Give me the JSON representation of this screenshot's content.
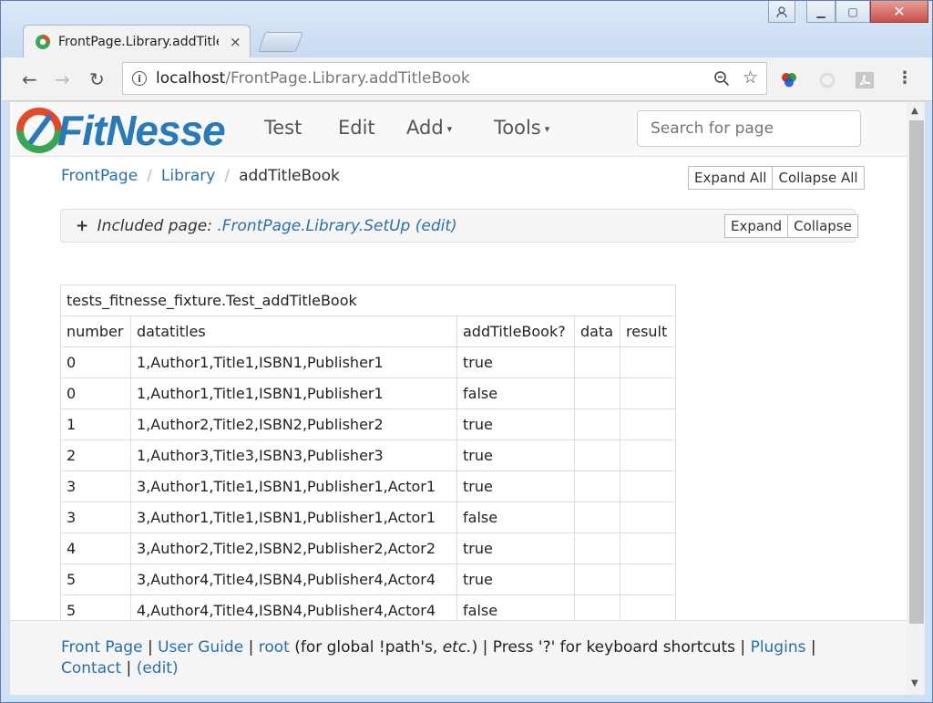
{
  "browser": {
    "tab_title": "FrontPage.Library.addTitle",
    "tab_close": "×",
    "url_host": "localhost",
    "url_path": "/FrontPage.Library.addTitleBook"
  },
  "header": {
    "logo_text": "FitNesse",
    "menu": [
      {
        "label": "Test",
        "caret": ""
      },
      {
        "label": "Edit",
        "caret": ""
      },
      {
        "label": "Add",
        "caret": "▾"
      },
      {
        "label": "Tools",
        "caret": "▾"
      }
    ],
    "search_placeholder": "Search for page"
  },
  "breadcrumb": {
    "items": [
      "FrontPage",
      "Library"
    ],
    "current": "addTitleBook",
    "separator": "/"
  },
  "page_buttons": {
    "expand_all": "Expand All",
    "collapse_all": "Collapse All"
  },
  "included": {
    "plus": "+",
    "label": "Included page:",
    "link": ".FrontPage.Library.SetUp",
    "edit": "(edit)",
    "expand": "Expand",
    "collapse": "Collapse"
  },
  "table": {
    "fixture": "tests_fitnesse_fixture.Test_addTitleBook",
    "headers": [
      "number",
      "datatitles",
      "addTitleBook?",
      "data",
      "result"
    ],
    "rows": [
      [
        "0",
        "1,Author1,Title1,ISBN1,Publisher1",
        "true",
        "",
        ""
      ],
      [
        "0",
        "1,Author1,Title1,ISBN1,Publisher1",
        "false",
        "",
        ""
      ],
      [
        "1",
        "1,Author2,Title2,ISBN2,Publisher2",
        "true",
        "",
        ""
      ],
      [
        "2",
        "1,Author3,Title3,ISBN3,Publisher3",
        "true",
        "",
        ""
      ],
      [
        "3",
        "3,Author1,Title1,ISBN1,Publisher1,Actor1",
        "true",
        "",
        ""
      ],
      [
        "3",
        "3,Author1,Title1,ISBN1,Publisher1,Actor1",
        "false",
        "",
        ""
      ],
      [
        "4",
        "3,Author2,Title2,ISBN2,Publisher2,Actor2",
        "true",
        "",
        ""
      ],
      [
        "5",
        "3,Author4,Title4,ISBN4,Publisher4,Actor4",
        "true",
        "",
        ""
      ],
      [
        "5",
        "4,Author4,Title4,ISBN4,Publisher4,Actor4",
        "false",
        "",
        ""
      ]
    ]
  },
  "footer": {
    "front_page": "Front Page",
    "user_guide": "User Guide",
    "root": "root",
    "root_note_a": " (for global !path's, ",
    "root_note_etc": "etc.",
    "root_note_b": ") | Press '?' for keyboard shortcuts | ",
    "plugins": "Plugins",
    "contact": "Contact",
    "edit": "(edit)",
    "sep": " | "
  },
  "colors": {
    "link": "#2a6fa8",
    "logo": "#2a7ab8"
  }
}
